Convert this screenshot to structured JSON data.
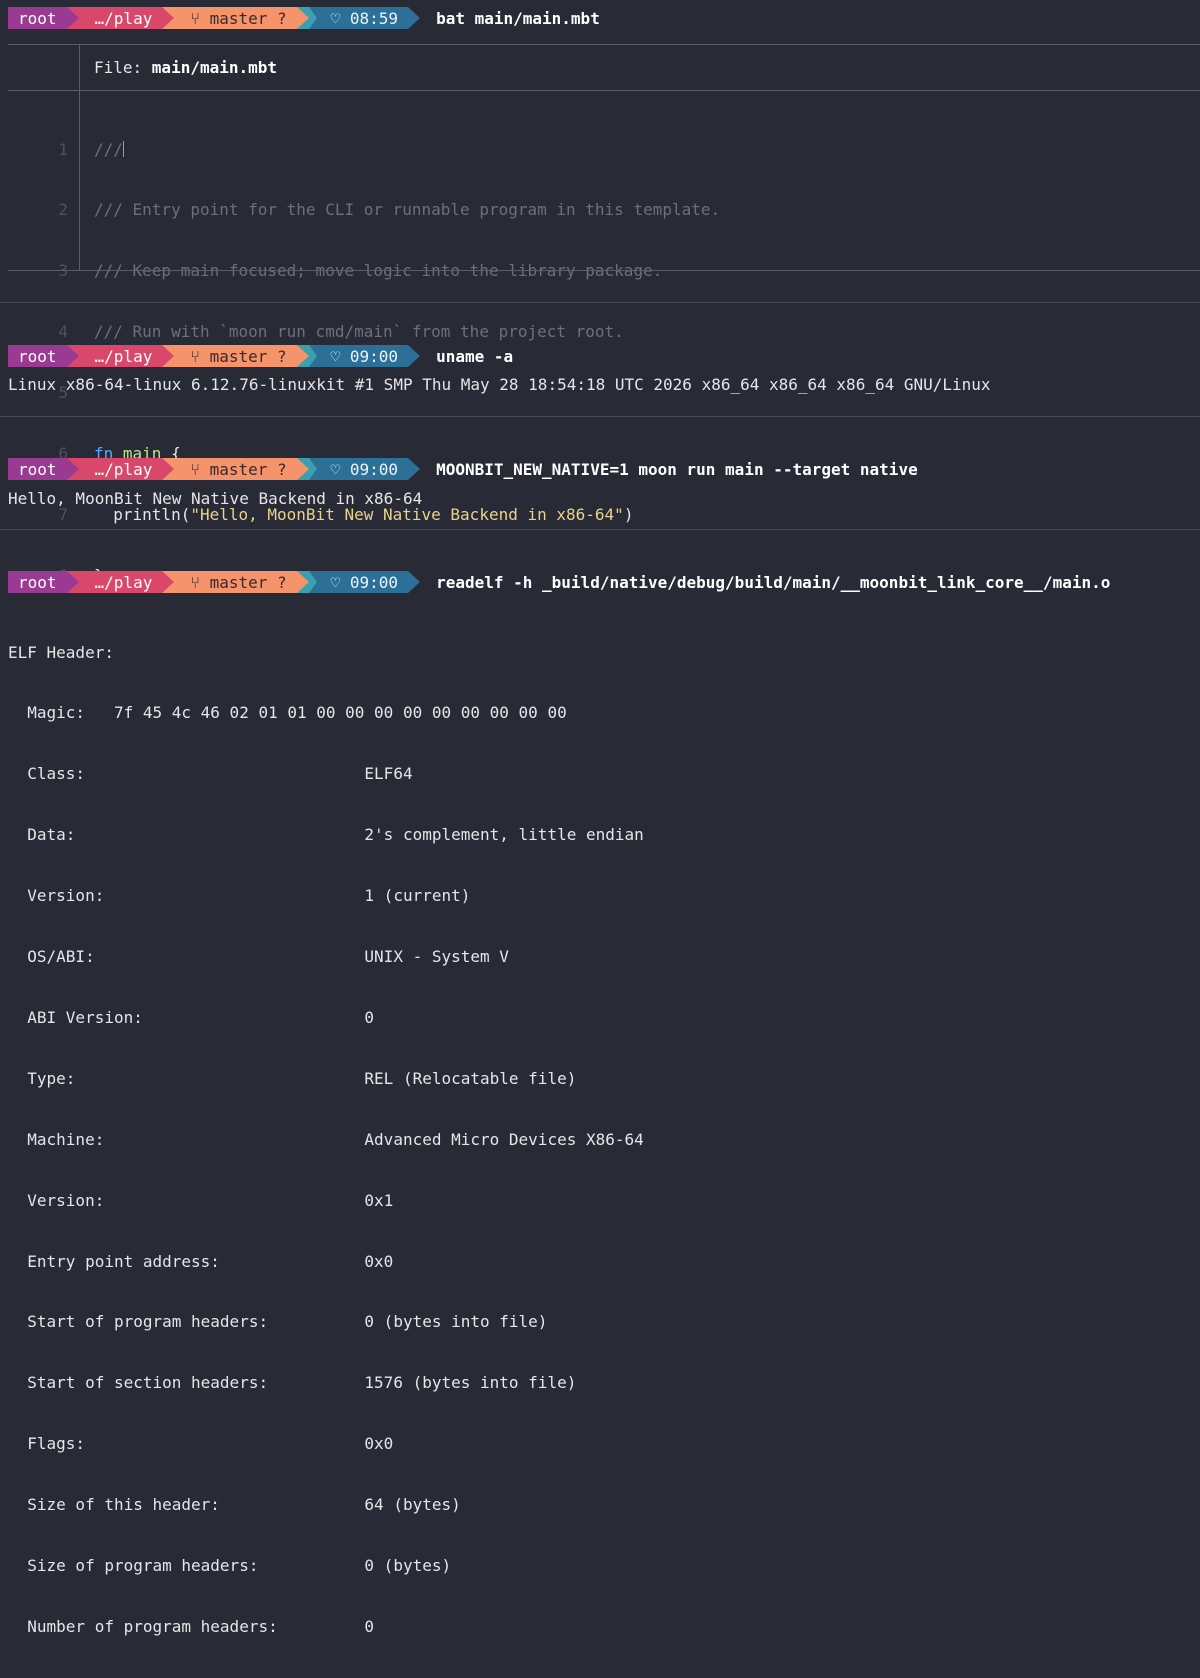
{
  "prompt": {
    "user": "root",
    "dir": "…/play",
    "branch_icon": "git-branch-icon",
    "branch": "master ?",
    "clock_icon": "heart-icon"
  },
  "blocks": [
    {
      "time": "08:59",
      "command": "bat main/main.mbt"
    },
    {
      "time": "09:00",
      "command": "uname -a"
    },
    {
      "time": "09:00",
      "command": "MOONBIT_NEW_NATIVE=1 moon run main --target native"
    },
    {
      "time": "09:00",
      "command": "readelf -h _build/native/debug/build/main/__moonbit_link_core__/main.o"
    }
  ],
  "bat": {
    "file_label": "File: ",
    "file_name": "main/main.mbt",
    "line_numbers": [
      "1",
      "2",
      "3",
      "4",
      "5",
      "6",
      "7",
      "8"
    ],
    "lines": [
      "///",
      "/// Entry point for the CLI or runnable program in this template.",
      "/// Keep main focused; move logic into the library package.",
      "/// Run with `moon run cmd/main` from the project root.",
      "",
      "fn main {",
      "  println(\"Hello, MoonBit New Native Backend in x86-64\")",
      "}"
    ],
    "kw_fn": "fn",
    "fn_name": "main",
    "brace_open": " {",
    "println_pre": "  println(",
    "println_str": "\"Hello, MoonBit New Native Backend in x86-64\"",
    "println_post": ")",
    "brace_close": "}"
  },
  "uname_output": "Linux x86-64-linux 6.12.76-linuxkit #1 SMP Thu May 28 18:54:18 UTC 2026 x86_64 x86_64 x86_64 GNU/Linux",
  "run_output": "Hello, MoonBit New Native Backend in x86-64",
  "readelf_output": [
    "ELF Header:",
    "  Magic:   7f 45 4c 46 02 01 01 00 00 00 00 00 00 00 00 00",
    "  Class:                             ELF64",
    "  Data:                              2's complement, little endian",
    "  Version:                           1 (current)",
    "  OS/ABI:                            UNIX - System V",
    "  ABI Version:                       0",
    "  Type:                              REL (Relocatable file)",
    "  Machine:                           Advanced Micro Devices X86-64",
    "  Version:                           0x1",
    "  Entry point address:               0x0",
    "  Start of program headers:          0 (bytes into file)",
    "  Start of section headers:          1576 (bytes into file)",
    "  Flags:                             0x0",
    "  Size of this header:               64 (bytes)",
    "  Size of program headers:           0 (bytes)",
    "  Number of program headers:         0"
  ]
}
